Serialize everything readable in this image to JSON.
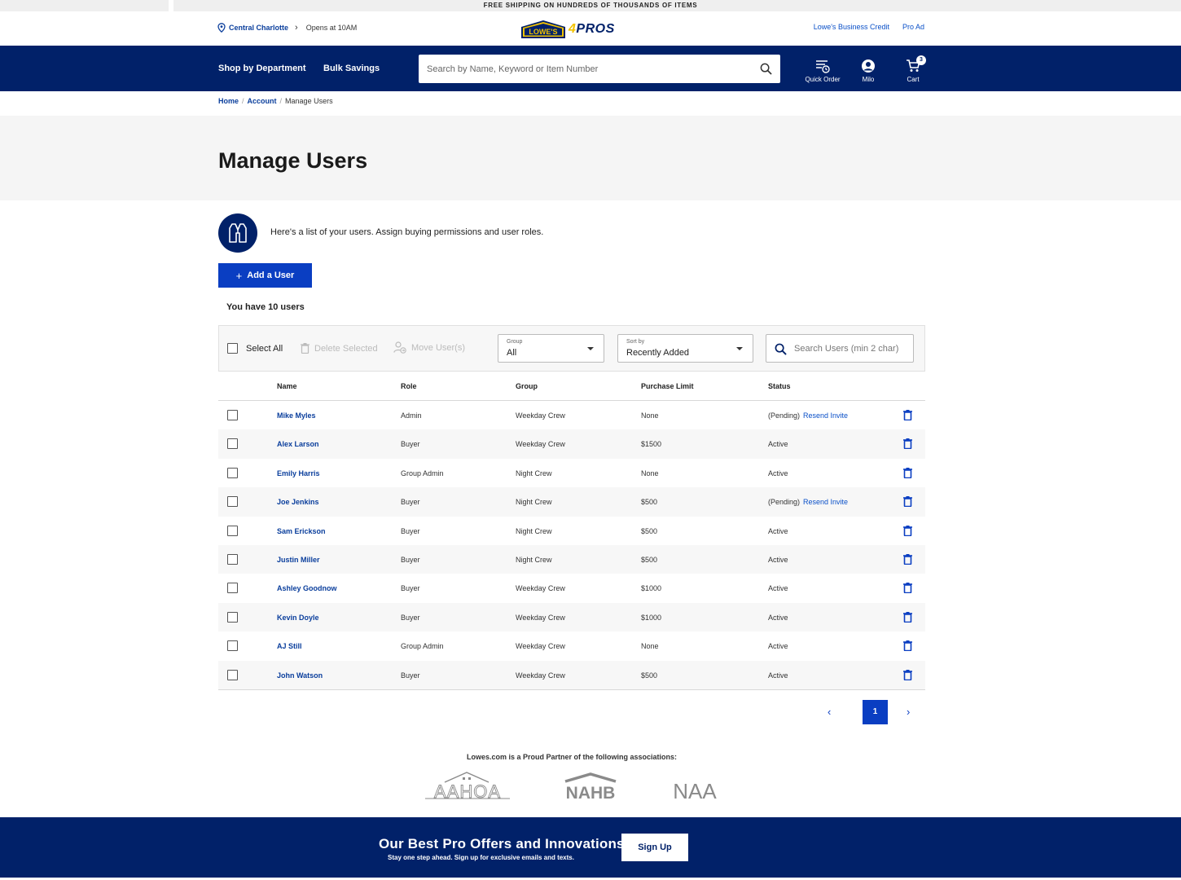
{
  "promo": "FREE SHIPPING ON HUNDREDS OF THOUSANDS OF ITEMS",
  "store": {
    "name": "Central Charlotte",
    "hours": "Opens at 10AM"
  },
  "logo": {
    "brand": "LOWE'S",
    "four": "4",
    "pros": "PROS"
  },
  "util_links": [
    "Lowe's Business Credit",
    "Pro Ad"
  ],
  "nav": {
    "shop": "Shop by Department",
    "bulk": "Bulk Savings",
    "search_placeholder": "Search by Name, Keyword or Item Number",
    "quick_order": "Quick Order",
    "account": "Milo",
    "cart": "Cart",
    "cart_count": "3"
  },
  "breadcrumb": {
    "home": "Home",
    "account": "Account",
    "current": "Manage Users"
  },
  "page_title": "Manage Users",
  "intro": "Here's a list of your users. Assign buying permissions and user roles.",
  "add_user": "Add a User",
  "user_count": "You have 10 users",
  "toolbar": {
    "select_all": "Select All",
    "delete_selected": "Delete Selected",
    "move_users": "Move User(s)",
    "group_label": "Group",
    "group_value": "All",
    "sort_label": "Sort by",
    "sort_value": "Recently Added",
    "search_placeholder": "Search Users (min 2 char)"
  },
  "table": {
    "headers": {
      "name": "Name",
      "role": "Role",
      "group": "Group",
      "limit": "Purchase Limit",
      "status": "Status"
    },
    "resend_label": "Resend Invite",
    "rows": [
      {
        "name": "Mike Myles",
        "role": "Admin",
        "group": "Weekday Crew",
        "limit": "None",
        "status": "(Pending)",
        "pending": true
      },
      {
        "name": "Alex Larson",
        "role": "Buyer",
        "group": "Weekday Crew",
        "limit": "$1500",
        "status": "Active",
        "pending": false
      },
      {
        "name": "Emily Harris",
        "role": "Group Admin",
        "group": "Night Crew",
        "limit": "None",
        "status": "Active",
        "pending": false
      },
      {
        "name": "Joe Jenkins",
        "role": "Buyer",
        "group": "Night Crew",
        "limit": "$500",
        "status": "(Pending)",
        "pending": true
      },
      {
        "name": "Sam Erickson",
        "role": "Buyer",
        "group": "Night Crew",
        "limit": "$500",
        "status": "Active",
        "pending": false
      },
      {
        "name": "Justin Miller",
        "role": "Buyer",
        "group": "Night Crew",
        "limit": "$500",
        "status": "Active",
        "pending": false
      },
      {
        "name": "Ashley Goodnow",
        "role": "Buyer",
        "group": "Weekday Crew",
        "limit": "$1000",
        "status": "Active",
        "pending": false
      },
      {
        "name": "Kevin Doyle",
        "role": "Buyer",
        "group": "Weekday Crew",
        "limit": "$1000",
        "status": "Active",
        "pending": false
      },
      {
        "name": "AJ Still",
        "role": "Group Admin",
        "group": "Weekday Crew",
        "limit": "None",
        "status": "Active",
        "pending": false
      },
      {
        "name": "John Watson",
        "role": "Buyer",
        "group": "Weekday Crew",
        "limit": "$500",
        "status": "Active",
        "pending": false
      }
    ]
  },
  "pagination": {
    "current_page": "1"
  },
  "partners": {
    "text": "Lowes.com is a Proud Partner of the following associations:",
    "logos": [
      "AAHOA",
      "NAHB",
      "NAA"
    ]
  },
  "footer": {
    "title": "Our Best Pro Offers and Innovations",
    "subtitle": "Stay one step ahead. Sign up for exclusive emails and texts.",
    "signup": "Sign Up"
  },
  "colors": {
    "navy": "#012169",
    "blue": "#0a3ec2",
    "link": "#0a50c8",
    "yellow": "#f2c200"
  }
}
